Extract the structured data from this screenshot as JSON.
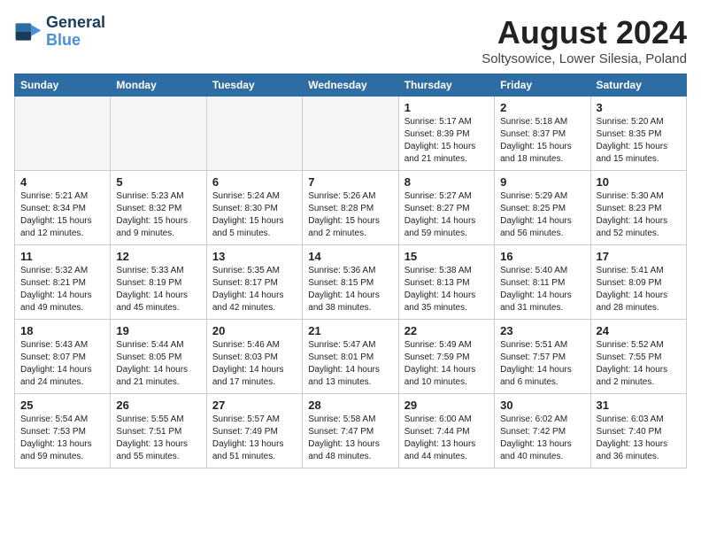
{
  "header": {
    "logo_line1": "General",
    "logo_line2": "Blue",
    "month_year": "August 2024",
    "location": "Soltysowice, Lower Silesia, Poland"
  },
  "weekdays": [
    "Sunday",
    "Monday",
    "Tuesday",
    "Wednesday",
    "Thursday",
    "Friday",
    "Saturday"
  ],
  "weeks": [
    [
      {
        "day": "",
        "info": "",
        "empty": true
      },
      {
        "day": "",
        "info": "",
        "empty": true
      },
      {
        "day": "",
        "info": "",
        "empty": true
      },
      {
        "day": "",
        "info": "",
        "empty": true
      },
      {
        "day": "1",
        "info": "Sunrise: 5:17 AM\nSunset: 8:39 PM\nDaylight: 15 hours\nand 21 minutes."
      },
      {
        "day": "2",
        "info": "Sunrise: 5:18 AM\nSunset: 8:37 PM\nDaylight: 15 hours\nand 18 minutes."
      },
      {
        "day": "3",
        "info": "Sunrise: 5:20 AM\nSunset: 8:35 PM\nDaylight: 15 hours\nand 15 minutes."
      }
    ],
    [
      {
        "day": "4",
        "info": "Sunrise: 5:21 AM\nSunset: 8:34 PM\nDaylight: 15 hours\nand 12 minutes."
      },
      {
        "day": "5",
        "info": "Sunrise: 5:23 AM\nSunset: 8:32 PM\nDaylight: 15 hours\nand 9 minutes."
      },
      {
        "day": "6",
        "info": "Sunrise: 5:24 AM\nSunset: 8:30 PM\nDaylight: 15 hours\nand 5 minutes."
      },
      {
        "day": "7",
        "info": "Sunrise: 5:26 AM\nSunset: 8:28 PM\nDaylight: 15 hours\nand 2 minutes."
      },
      {
        "day": "8",
        "info": "Sunrise: 5:27 AM\nSunset: 8:27 PM\nDaylight: 14 hours\nand 59 minutes."
      },
      {
        "day": "9",
        "info": "Sunrise: 5:29 AM\nSunset: 8:25 PM\nDaylight: 14 hours\nand 56 minutes."
      },
      {
        "day": "10",
        "info": "Sunrise: 5:30 AM\nSunset: 8:23 PM\nDaylight: 14 hours\nand 52 minutes."
      }
    ],
    [
      {
        "day": "11",
        "info": "Sunrise: 5:32 AM\nSunset: 8:21 PM\nDaylight: 14 hours\nand 49 minutes."
      },
      {
        "day": "12",
        "info": "Sunrise: 5:33 AM\nSunset: 8:19 PM\nDaylight: 14 hours\nand 45 minutes."
      },
      {
        "day": "13",
        "info": "Sunrise: 5:35 AM\nSunset: 8:17 PM\nDaylight: 14 hours\nand 42 minutes."
      },
      {
        "day": "14",
        "info": "Sunrise: 5:36 AM\nSunset: 8:15 PM\nDaylight: 14 hours\nand 38 minutes."
      },
      {
        "day": "15",
        "info": "Sunrise: 5:38 AM\nSunset: 8:13 PM\nDaylight: 14 hours\nand 35 minutes."
      },
      {
        "day": "16",
        "info": "Sunrise: 5:40 AM\nSunset: 8:11 PM\nDaylight: 14 hours\nand 31 minutes."
      },
      {
        "day": "17",
        "info": "Sunrise: 5:41 AM\nSunset: 8:09 PM\nDaylight: 14 hours\nand 28 minutes."
      }
    ],
    [
      {
        "day": "18",
        "info": "Sunrise: 5:43 AM\nSunset: 8:07 PM\nDaylight: 14 hours\nand 24 minutes."
      },
      {
        "day": "19",
        "info": "Sunrise: 5:44 AM\nSunset: 8:05 PM\nDaylight: 14 hours\nand 21 minutes."
      },
      {
        "day": "20",
        "info": "Sunrise: 5:46 AM\nSunset: 8:03 PM\nDaylight: 14 hours\nand 17 minutes."
      },
      {
        "day": "21",
        "info": "Sunrise: 5:47 AM\nSunset: 8:01 PM\nDaylight: 14 hours\nand 13 minutes."
      },
      {
        "day": "22",
        "info": "Sunrise: 5:49 AM\nSunset: 7:59 PM\nDaylight: 14 hours\nand 10 minutes."
      },
      {
        "day": "23",
        "info": "Sunrise: 5:51 AM\nSunset: 7:57 PM\nDaylight: 14 hours\nand 6 minutes."
      },
      {
        "day": "24",
        "info": "Sunrise: 5:52 AM\nSunset: 7:55 PM\nDaylight: 14 hours\nand 2 minutes."
      }
    ],
    [
      {
        "day": "25",
        "info": "Sunrise: 5:54 AM\nSunset: 7:53 PM\nDaylight: 13 hours\nand 59 minutes."
      },
      {
        "day": "26",
        "info": "Sunrise: 5:55 AM\nSunset: 7:51 PM\nDaylight: 13 hours\nand 55 minutes."
      },
      {
        "day": "27",
        "info": "Sunrise: 5:57 AM\nSunset: 7:49 PM\nDaylight: 13 hours\nand 51 minutes."
      },
      {
        "day": "28",
        "info": "Sunrise: 5:58 AM\nSunset: 7:47 PM\nDaylight: 13 hours\nand 48 minutes."
      },
      {
        "day": "29",
        "info": "Sunrise: 6:00 AM\nSunset: 7:44 PM\nDaylight: 13 hours\nand 44 minutes."
      },
      {
        "day": "30",
        "info": "Sunrise: 6:02 AM\nSunset: 7:42 PM\nDaylight: 13 hours\nand 40 minutes."
      },
      {
        "day": "31",
        "info": "Sunrise: 6:03 AM\nSunset: 7:40 PM\nDaylight: 13 hours\nand 36 minutes."
      }
    ]
  ]
}
